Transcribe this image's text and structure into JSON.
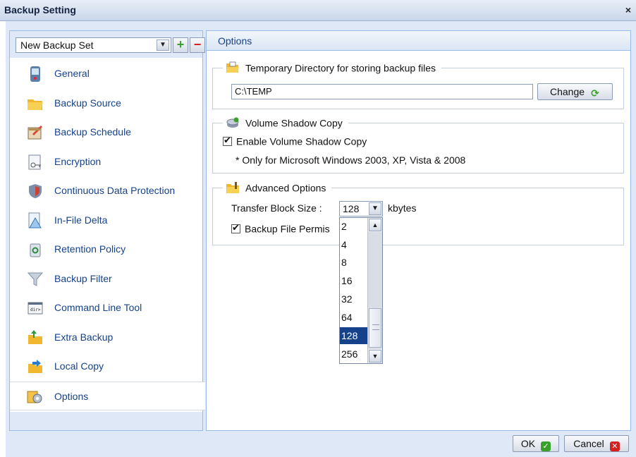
{
  "window": {
    "title": "Backup Setting",
    "close_glyph": "×"
  },
  "sidebar": {
    "backup_set": "New Backup Set",
    "add_glyph": "+",
    "remove_glyph": "−",
    "items": [
      {
        "label": "General",
        "icon": "phone-icon"
      },
      {
        "label": "Backup Source",
        "icon": "folder-icon"
      },
      {
        "label": "Backup Schedule",
        "icon": "calendar-icon"
      },
      {
        "label": "Encryption",
        "icon": "encryption-icon"
      },
      {
        "label": "Continuous Data Protection",
        "icon": "shield-icon"
      },
      {
        "label": "In-File Delta",
        "icon": "delta-icon"
      },
      {
        "label": "Retention Policy",
        "icon": "bin-icon"
      },
      {
        "label": "Backup Filter",
        "icon": "filter-icon"
      },
      {
        "label": "Command Line Tool",
        "icon": "command-line-icon"
      },
      {
        "label": "Extra Backup",
        "icon": "extra-backup-icon"
      },
      {
        "label": "Local Copy",
        "icon": "local-copy-icon"
      },
      {
        "label": "Options",
        "icon": "options-icon"
      }
    ],
    "selected_index": 11
  },
  "options": {
    "header": "Options",
    "temp_dir": {
      "legend": "Temporary Directory for storing backup files",
      "value": "C:\\TEMP",
      "change_label": "Change"
    },
    "vss": {
      "legend": "Volume Shadow Copy",
      "checkbox_label": "Enable Volume Shadow Copy",
      "checked": true,
      "note": "* Only for Microsoft Windows 2003, XP, Vista & 2008"
    },
    "advanced": {
      "legend": "Advanced Options",
      "block_size_label": "Transfer Block Size :",
      "block_size_value": "128",
      "unit": "kbytes",
      "permissions_label": "Backup File Permis",
      "permissions_checked": true,
      "dropdown_options": [
        "2",
        "4",
        "8",
        "16",
        "32",
        "64",
        "128",
        "256"
      ],
      "dropdown_selected": "128"
    }
  },
  "footer": {
    "ok_label": "OK",
    "cancel_label": "Cancel"
  },
  "colors": {
    "accent": "#15428b",
    "panel_bg": "#dfe8f6",
    "ok_icon": "#3aa02c",
    "cancel_icon": "#d62020"
  }
}
